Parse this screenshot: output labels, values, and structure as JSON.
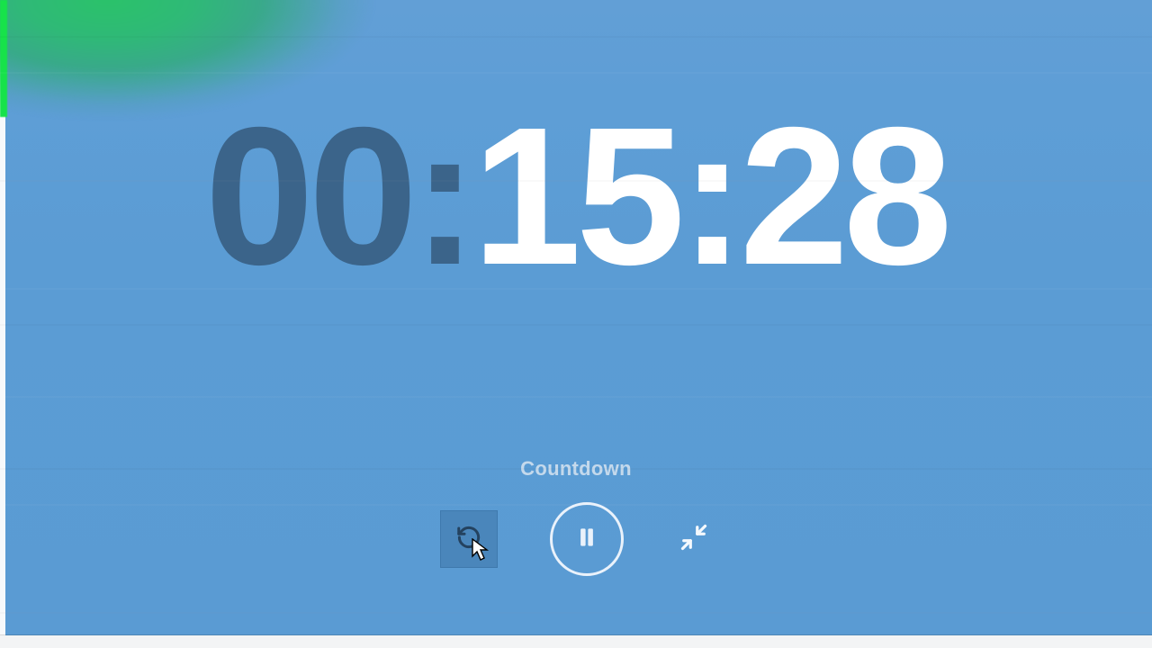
{
  "timer": {
    "hours": "00",
    "sep1": ":",
    "minutes": "15",
    "sep2": ":",
    "seconds": "28"
  },
  "label": "Countdown",
  "buttons": {
    "reset": "reset",
    "pause": "pause",
    "collapse": "exit-fullscreen"
  },
  "colors": {
    "bg": "#5b9cd4",
    "accent_green": "#2bc26a",
    "time_dim": "#3b648a",
    "time_bright": "#ffffff"
  }
}
